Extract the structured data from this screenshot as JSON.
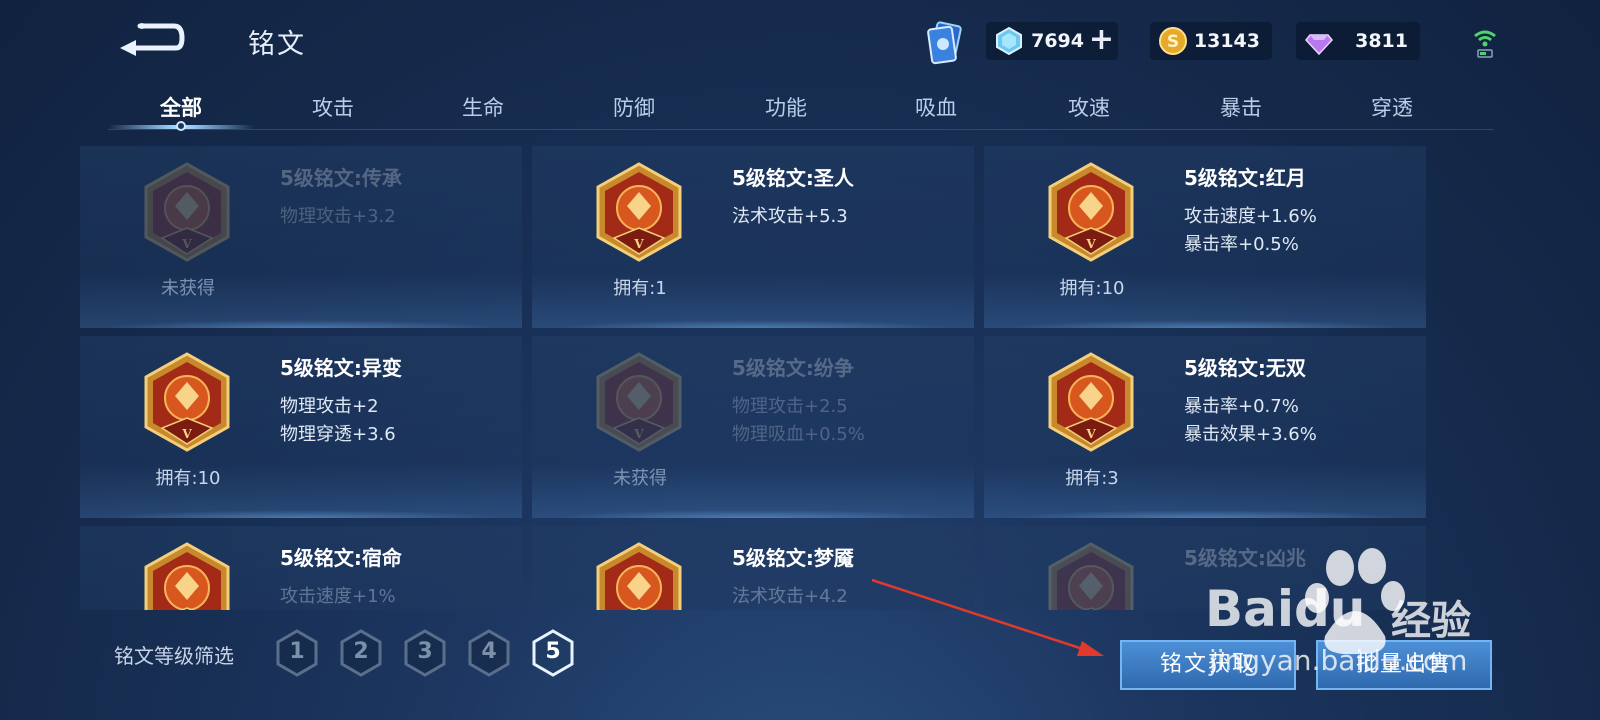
{
  "header": {
    "title": "铭文",
    "currencies": [
      {
        "name": "diamond",
        "value": "7694",
        "icon": "crystal-icon",
        "color": "#8fd8f5"
      },
      {
        "name": "gold",
        "value": "13143",
        "icon": "coin-icon",
        "color": "#f3c74e"
      },
      {
        "name": "gem",
        "value": "3811",
        "icon": "gem-icon",
        "color": "#c58cf7"
      }
    ],
    "plus": "+"
  },
  "tabs": [
    "全部",
    "攻击",
    "生命",
    "防御",
    "功能",
    "吸血",
    "攻速",
    "暴击",
    "穿透"
  ],
  "active_tab": 0,
  "runes": [
    {
      "name": "5级铭文:传承",
      "stats": [
        "物理攻击+3.2"
      ],
      "owned": "未获得",
      "locked": true
    },
    {
      "name": "5级铭文:圣人",
      "stats": [
        "法术攻击+5.3"
      ],
      "owned": "拥有:1",
      "locked": false
    },
    {
      "name": "5级铭文:红月",
      "stats": [
        "攻击速度+1.6%",
        "暴击率+0.5%"
      ],
      "owned": "拥有:10",
      "locked": false
    },
    {
      "name": "5级铭文:异变",
      "stats": [
        "物理攻击+2",
        "物理穿透+3.6"
      ],
      "owned": "拥有:10",
      "locked": false
    },
    {
      "name": "5级铭文:纷争",
      "stats": [
        "物理攻击+2.5",
        "物理吸血+0.5%"
      ],
      "owned": "未获得",
      "locked": true
    },
    {
      "name": "5级铭文:无双",
      "stats": [
        "暴击率+0.7%",
        "暴击效果+3.6%"
      ],
      "owned": "拥有:3",
      "locked": false
    },
    {
      "name": "5级铭文:宿命",
      "stats": [
        "攻击速度+1%"
      ],
      "owned": "",
      "locked": false
    },
    {
      "name": "5级铭文:梦魇",
      "stats": [
        "法术攻击+4.2"
      ],
      "owned": "",
      "locked": false
    },
    {
      "name": "5级铭文:凶兆",
      "stats": [],
      "owned": "",
      "locked": true
    }
  ],
  "badge_letter": "V",
  "filter": {
    "label": "铭文等级筛选",
    "levels": [
      "1",
      "2",
      "3",
      "4",
      "5"
    ],
    "selected": "5"
  },
  "buttons": {
    "obtain": "铭文获取",
    "bulk_sell": "批量出售"
  },
  "watermark": {
    "brand": "Baidu",
    "suffix": "经验",
    "url": "jingyan.baidu.com"
  }
}
